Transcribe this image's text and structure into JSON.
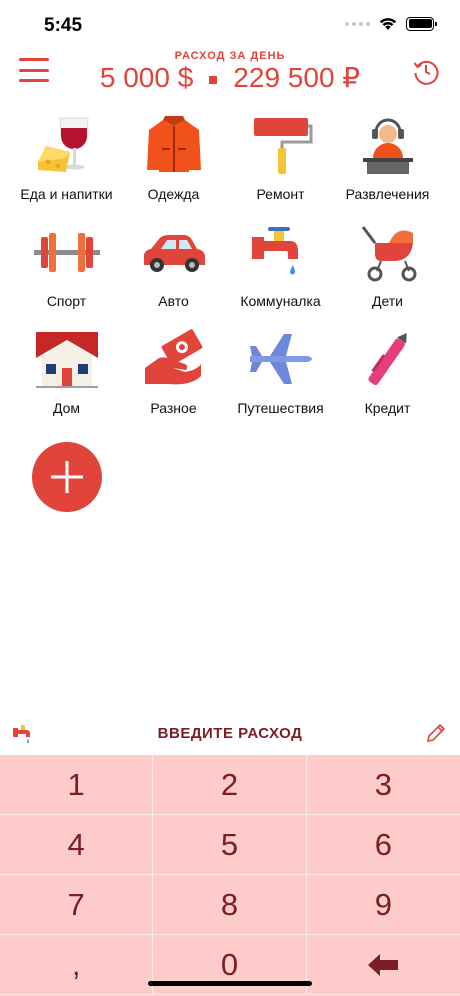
{
  "status_bar": {
    "time": "5:45"
  },
  "header": {
    "subtitle": "РАСХОД ЗА ДЕНЬ",
    "amount_usd": "5 000 $",
    "amount_rub": "229 500 ₽"
  },
  "categories": [
    {
      "label": "Еда и напитки",
      "icon": "wine-cheese-icon"
    },
    {
      "label": "Одежда",
      "icon": "jacket-icon"
    },
    {
      "label": "Ремонт",
      "icon": "paint-roller-icon"
    },
    {
      "label": "Развлечения",
      "icon": "dj-icon"
    },
    {
      "label": "Спорт",
      "icon": "dumbbell-icon"
    },
    {
      "label": "Авто",
      "icon": "car-icon"
    },
    {
      "label": "Коммуналка",
      "icon": "water-tap-icon"
    },
    {
      "label": "Дети",
      "icon": "baby-stroller-icon"
    },
    {
      "label": "Дом",
      "icon": "house-icon"
    },
    {
      "label": "Разное",
      "icon": "hand-money-icon"
    },
    {
      "label": "Путешествия",
      "icon": "airplane-icon"
    },
    {
      "label": "Кредит",
      "icon": "pen-icon"
    }
  ],
  "add_category": {
    "icon": "plus-icon"
  },
  "entry": {
    "label": "ВВЕДИТЕ РАСХОД"
  },
  "keypad": {
    "keys": [
      "1",
      "2",
      "3",
      "4",
      "5",
      "6",
      "7",
      "8",
      "9",
      ",",
      "0",
      ""
    ],
    "backspace_icon": "backspace-arrow-icon"
  },
  "colors": {
    "accent": "#e0443a",
    "keypad_bg": "#ffcccc",
    "keypad_text": "#7c1d28"
  }
}
